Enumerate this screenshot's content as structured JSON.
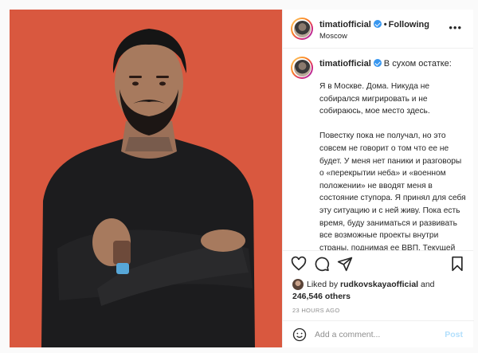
{
  "post": {
    "username": "timatiofficial",
    "follow_label": "Following",
    "location": "Moscow",
    "caption_intro": "В сухом остатке:",
    "caption_paragraphs": [
      "Я в Москве. Дома. Никуда не собирался мигрировать и не собираюсь, мое место здесь.",
      "Повестку пока не получал, но это совсем не говорит о том что ее не будет. У меня нет паники и разговоры о «перекрытии неба» и «военном положении» не вводят меня в состояние ступора. Я принял для себя эту ситуацию и с ней живу. Пока есть время, буду заниматься и развивать все возможные проекты внутри страны, поднимая ее ВВП. Текущей операционной деятельности много, спрос на"
    ],
    "liked_by_prefix": "Liked by",
    "liked_by_user": "rudkovskayaofficial",
    "liked_by_and": "and",
    "likes_count": "246,546 others",
    "timestamp": "23 HOURS AGO"
  },
  "comment_box": {
    "placeholder": "Add a comment...",
    "post_label": "Post"
  },
  "icons": [
    "more-options-icon",
    "heart-icon",
    "comment-icon",
    "share-icon",
    "bookmark-icon",
    "emoji-icon",
    "verified-badge-icon"
  ],
  "colors": {
    "photo_background": "#d9583f",
    "verified": "#3897f0",
    "post_button": "#b2dffc",
    "muted_text": "#8e8e8e"
  }
}
